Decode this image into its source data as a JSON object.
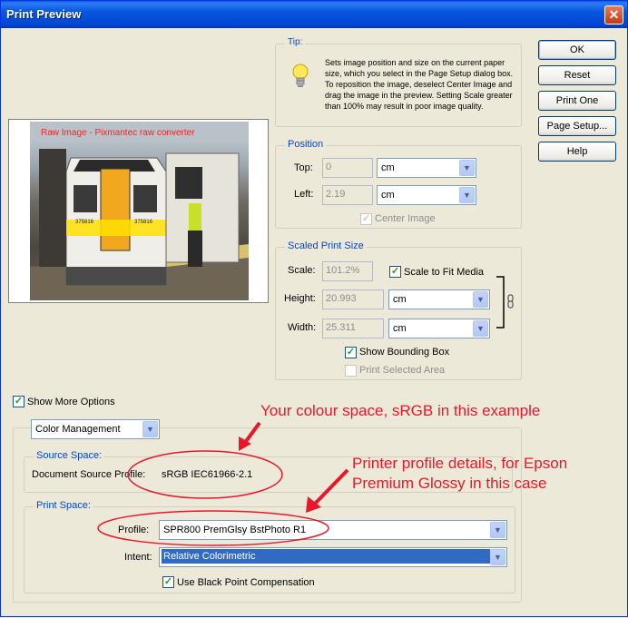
{
  "window": {
    "title": "Print Preview",
    "close": "✕"
  },
  "tip": {
    "legend": "Tip:",
    "text": "Sets image position and size on the current paper size, which you select in the Page Setup dialog box. To reposition the image, deselect Center Image and drag the image in the preview. Setting Scale greater than 100% may result in poor image quality."
  },
  "buttons": {
    "ok": "OK",
    "reset": "Reset",
    "print_one": "Print One",
    "page_setup": "Page Setup...",
    "help": "Help"
  },
  "preview": {
    "caption": "Raw Image - Pixmantec raw converter",
    "train_number_left": "375816",
    "train_number_right": "375816"
  },
  "position": {
    "legend": "Position",
    "top_label": "Top:",
    "top_value": "0",
    "top_unit": "cm",
    "left_label": "Left:",
    "left_value": "2.19",
    "left_unit": "cm",
    "center_image": "Center Image"
  },
  "scaled": {
    "legend": "Scaled Print Size",
    "scale_label": "Scale:",
    "scale_value": "101.2%",
    "fit_media": "Scale to Fit Media",
    "height_label": "Height:",
    "height_value": "20.993",
    "height_unit": "cm",
    "width_label": "Width:",
    "width_value": "25.311",
    "width_unit": "cm",
    "bounding_box": "Show Bounding Box",
    "print_selected": "Print Selected Area"
  },
  "more_options": {
    "label": "Show More Options",
    "dropdown": "Color Management"
  },
  "source": {
    "legend": "Source Space:",
    "doc_label": "Document Source Profile:",
    "doc_value": "sRGB IEC61966-2.1"
  },
  "print_space": {
    "legend": "Print Space:",
    "profile_label": "Profile:",
    "profile_value": "SPR800 PremGlsy BstPhoto R1",
    "intent_label": "Intent:",
    "intent_value": "Relative Colorimetric",
    "black_point": "Use Black Point Compensation"
  },
  "annotations": {
    "colour_space": "Your colour space, sRGB in this example",
    "printer_line1": "Printer profile details, for Epson",
    "printer_line2": "Premium Glossy in this case"
  },
  "colors": {
    "annotation": "#e8182a",
    "selection": "#316ac5",
    "title_bar": "#0046d5"
  }
}
